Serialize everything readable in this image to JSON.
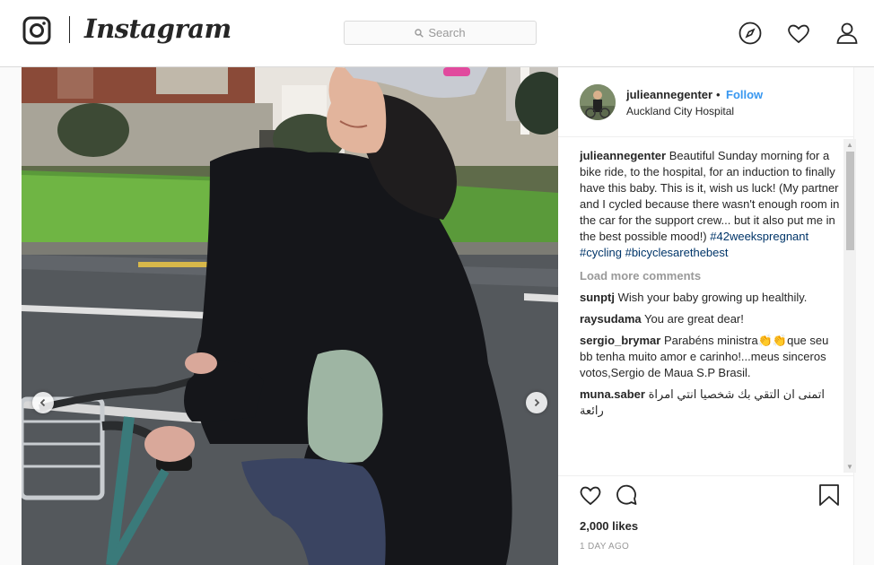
{
  "brand": {
    "name": "Instagram"
  },
  "search": {
    "placeholder": "Search"
  },
  "nav": {
    "icons": [
      "compass-icon",
      "heart-icon",
      "user-icon"
    ]
  },
  "post": {
    "username": "julieannegenter",
    "separator": "•",
    "follow_label": "Follow",
    "location": "Auckland City Hospital",
    "caption": {
      "user": "julieannegenter",
      "text": "Beautiful Sunday morning for a bike ride, to the hospital, for an induction to finally have this baby. This is it, wish us luck! (My partner and I cycled because there wasn't enough room in the car for the support crew... but it also put me in the best possible mood!)",
      "tags": [
        "#42weekspregnant",
        "#cycling",
        "#bicyclesarethebest"
      ]
    },
    "load_more": "Load more comments",
    "comments": [
      {
        "user": "sunptj",
        "text": "Wish your baby growing up healthily."
      },
      {
        "user": "raysudama",
        "text": "You are great dear!"
      },
      {
        "user": "sergio_brymar",
        "text": "Parabéns ministra👏👏que seu bb tenha muito amor e carinho!...meus sinceros votos,Sergio de Maua S.P Brasil."
      },
      {
        "user": "muna.saber",
        "text": "اتمنى ان التقي بك شخصيا انتي امراة رائعة"
      }
    ],
    "likes": "2,000 likes",
    "time": "1 DAY AGO"
  },
  "colors": {
    "accent": "#3897f0",
    "hashtag": "#003569",
    "border": "#dbdbdb"
  }
}
